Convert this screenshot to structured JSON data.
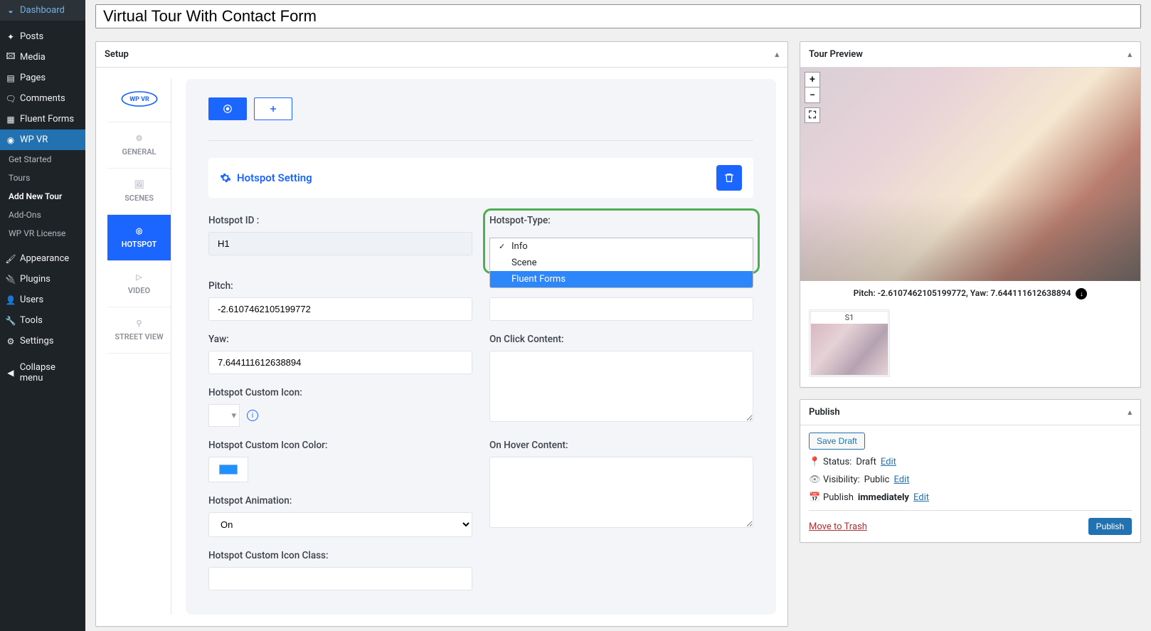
{
  "title": "Virtual Tour With Contact Form",
  "sidebar": {
    "items": [
      {
        "label": "Dashboard",
        "icon": "gauge"
      },
      {
        "label": "Posts",
        "icon": "pin"
      },
      {
        "label": "Media",
        "icon": "media"
      },
      {
        "label": "Pages",
        "icon": "page"
      },
      {
        "label": "Comments",
        "icon": "comment"
      },
      {
        "label": "Fluent Forms",
        "icon": "form"
      },
      {
        "label": "WP VR",
        "icon": "vr",
        "active": true
      },
      {
        "label": "Appearance",
        "icon": "brush"
      },
      {
        "label": "Plugins",
        "icon": "plug"
      },
      {
        "label": "Users",
        "icon": "user"
      },
      {
        "label": "Tools",
        "icon": "tool"
      },
      {
        "label": "Settings",
        "icon": "sliders"
      },
      {
        "label": "Collapse menu",
        "icon": "collapse"
      }
    ],
    "sub_items": [
      "Get Started",
      "Tours",
      "Add New Tour",
      "Add-Ons",
      "WP VR License"
    ],
    "sub_active_index": 2
  },
  "setup": {
    "box_title": "Setup",
    "tabs": [
      "GENERAL",
      "SCENES",
      "HOTSPOT",
      "VIDEO",
      "STREET VIEW"
    ],
    "active_tab_index": 2,
    "section_title": "Hotspot Setting",
    "fields": {
      "hotspot_id_label": "Hotspot ID :",
      "hotspot_id_value": "H1",
      "hotspot_type_label": "Hotspot-Type:",
      "hotspot_type_options": [
        "Info",
        "Scene",
        "Fluent Forms"
      ],
      "hotspot_type_selected_index": 0,
      "hotspot_type_highlighted_index": 2,
      "pitch_label": "Pitch:",
      "pitch_value": "-2.6107462105199772",
      "yaw_label": "Yaw:",
      "yaw_value": "7.644111612638894",
      "custom_icon_label": "Hotspot Custom Icon:",
      "custom_icon_color_label": "Hotspot Custom Icon Color:",
      "custom_icon_color": "#1e90ff",
      "animation_label": "Hotspot Animation:",
      "animation_value": "On",
      "custom_icon_class_label": "Hotspot Custom Icon Class:",
      "onclick_label": "On Click Content:",
      "onhover_label": "On Hover Content:"
    }
  },
  "preview": {
    "box_title": "Tour Preview",
    "pitchyaw_text": "Pitch: -2.6107462105199772, Yaw: 7.644111612638894",
    "scene_label": "S1"
  },
  "publish": {
    "box_title": "Publish",
    "save_draft": "Save Draft",
    "status_label": "Status:",
    "status_value": "Draft",
    "visibility_label": "Visibility:",
    "visibility_value": "Public",
    "schedule_label": "Publish",
    "schedule_value": "immediately",
    "edit": "Edit",
    "trash": "Move to Trash",
    "publish_btn": "Publish"
  }
}
